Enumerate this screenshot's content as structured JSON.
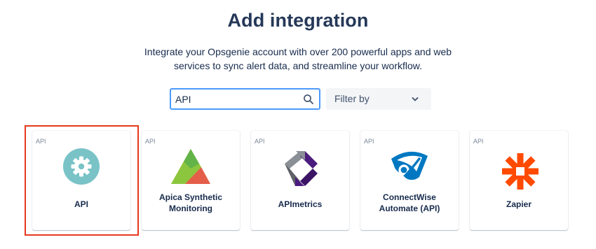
{
  "header": {
    "title": "Add integration",
    "subtitle_line1": "Integrate your Opsgenie account with over 200 powerful apps and web",
    "subtitle_line2": "services to sync alert data, and streamline your workflow."
  },
  "search": {
    "value": "API"
  },
  "filter": {
    "label": "Filter by"
  },
  "cards": [
    {
      "tag": "API",
      "name": "API",
      "icon": "gear-icon",
      "selected": true
    },
    {
      "tag": "API",
      "name_line1": "Apica Synthetic",
      "name_line2": "Monitoring",
      "icon": "apica-logo"
    },
    {
      "tag": "API",
      "name": "APImetrics",
      "icon": "apimetrics-logo"
    },
    {
      "tag": "API",
      "name_line1": "ConnectWise",
      "name_line2": "Automate (API)",
      "icon": "connectwise-logo"
    },
    {
      "tag": "API",
      "name": "Zapier",
      "icon": "zapier-logo"
    }
  ],
  "colors": {
    "focus_border": "#4c9aff",
    "selection_outline": "#e5391e",
    "api_icon_bg": "#79c3c7",
    "connectwise_blue": "#0078c1",
    "zapier_orange": "#ff4a00"
  }
}
